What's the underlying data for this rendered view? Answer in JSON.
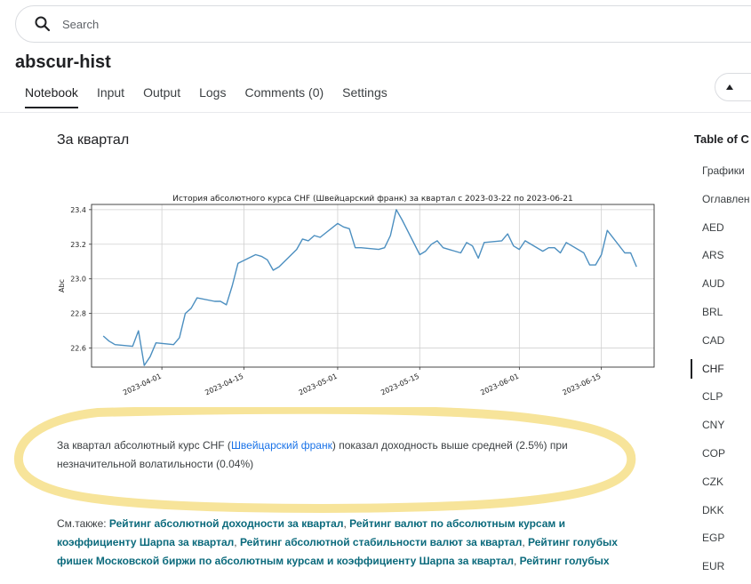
{
  "search": {
    "placeholder": "Search"
  },
  "kernel": {
    "title": "abscur-hist"
  },
  "tabs": [
    {
      "label": "Notebook"
    },
    {
      "label": "Input"
    },
    {
      "label": "Output"
    },
    {
      "label": "Logs"
    },
    {
      "label": "Comments (0)"
    },
    {
      "label": "Settings"
    }
  ],
  "section": {
    "heading": "За квартал"
  },
  "chart_data": {
    "type": "line",
    "title": "История абсолютного курса CHF (Швейцарский франк) за квартал с 2023-03-22 по 2023-06-21",
    "xlabel": "",
    "ylabel": "Abc",
    "ylim": [
      22.49,
      23.43
    ],
    "x_range": [
      "2023-03-20",
      "2023-06-24"
    ],
    "yticks": [
      "22.6",
      "22.8",
      "23.0",
      "23.2",
      "23.4"
    ],
    "xticks": [
      "2023-04-01",
      "2023-04-15",
      "2023-05-01",
      "2023-05-15",
      "2023-06-01",
      "2023-06-15"
    ],
    "grid": true,
    "color": "#4c8fc0",
    "series": [
      {
        "x": [
          "2023-03-22",
          "2023-03-23",
          "2023-03-24",
          "2023-03-27",
          "2023-03-28",
          "2023-03-29",
          "2023-03-30",
          "2023-03-31",
          "2023-04-03",
          "2023-04-04",
          "2023-04-05",
          "2023-04-06",
          "2023-04-07",
          "2023-04-10",
          "2023-04-11",
          "2023-04-12",
          "2023-04-13",
          "2023-04-14",
          "2023-04-17",
          "2023-04-18",
          "2023-04-19",
          "2023-04-20",
          "2023-04-21",
          "2023-04-24",
          "2023-04-25",
          "2023-04-26",
          "2023-04-27",
          "2023-04-28",
          "2023-05-01",
          "2023-05-02",
          "2023-05-03",
          "2023-05-04",
          "2023-05-05",
          "2023-05-08",
          "2023-05-09",
          "2023-05-10",
          "2023-05-11",
          "2023-05-12",
          "2023-05-15",
          "2023-05-16",
          "2023-05-17",
          "2023-05-18",
          "2023-05-19",
          "2023-05-22",
          "2023-05-23",
          "2023-05-24",
          "2023-05-25",
          "2023-05-26",
          "2023-05-29",
          "2023-05-30",
          "2023-05-31",
          "2023-06-01",
          "2023-06-02",
          "2023-06-05",
          "2023-06-06",
          "2023-06-07",
          "2023-06-08",
          "2023-06-09",
          "2023-06-12",
          "2023-06-13",
          "2023-06-14",
          "2023-06-15",
          "2023-06-16",
          "2023-06-19",
          "2023-06-20",
          "2023-06-21"
        ],
        "values": [
          22.67,
          22.64,
          22.62,
          22.61,
          22.7,
          22.5,
          22.55,
          22.63,
          22.62,
          22.66,
          22.8,
          22.83,
          22.89,
          22.87,
          22.87,
          22.85,
          22.96,
          23.09,
          23.14,
          23.13,
          23.11,
          23.05,
          23.07,
          23.17,
          23.23,
          23.22,
          23.25,
          23.24,
          23.32,
          23.3,
          23.29,
          23.18,
          23.18,
          23.17,
          23.18,
          23.25,
          23.4,
          23.34,
          23.14,
          23.16,
          23.2,
          23.22,
          23.18,
          23.15,
          23.21,
          23.19,
          23.12,
          23.21,
          23.22,
          23.26,
          23.19,
          23.17,
          23.22,
          23.16,
          23.18,
          23.18,
          23.15,
          23.21,
          23.15,
          23.08,
          23.08,
          23.14,
          23.28,
          23.15,
          23.15,
          23.07
        ]
      }
    ]
  },
  "description": {
    "prefix": "За квартал абсолютный курс CHF (",
    "link": "Швейцарский франк",
    "suffix": ") показал доходность выше средней (2.5%) при незначительной волатильности (0.04%)"
  },
  "see_also": {
    "label": "См.также:",
    "links": [
      "Рейтинг абсолютной доходности за квартал",
      "Рейтинг валют по абсолютным курсам и коэффициенту Шарпа за квартал",
      "Рейтинг абсолютной стабильности валют за квартал",
      "Рейтинг голубых фишек Московской биржи по абсолютным курсам и коэффициенту Шарпа за квартал",
      "Рейтинг голубых"
    ]
  },
  "toc": {
    "heading": "Table of C",
    "items": [
      "Графики",
      "Оглавлен",
      "AED",
      "ARS",
      "AUD",
      "BRL",
      "CAD",
      "CHF",
      "CLP",
      "CNY",
      "COP",
      "CZK",
      "DKK",
      "EGP",
      "EUR"
    ],
    "active": "CHF"
  },
  "icons": {
    "search": "search-icon",
    "up": "arrow-up-icon",
    "annotation": "hand-drawn-ellipse"
  },
  "colors": {
    "accent": "#202124",
    "link": "#1a73e8",
    "see_link": "#0b6a7c",
    "annotation": "#f7e49a"
  }
}
